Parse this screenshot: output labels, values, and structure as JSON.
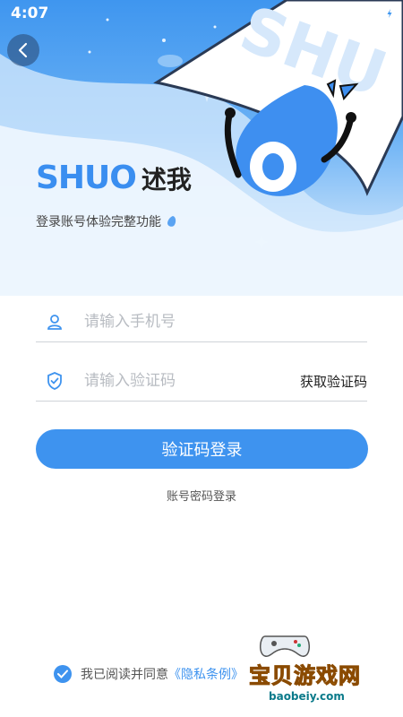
{
  "status_bar": {
    "time": "4:07"
  },
  "logo": {
    "en": "SHUO",
    "cn": "述我"
  },
  "subtitle": "登录账号体验完整功能",
  "phone_field": {
    "placeholder": "请输入手机号",
    "value": ""
  },
  "code_field": {
    "placeholder": "请输入验证码",
    "value": "",
    "get_code_label": "获取验证码"
  },
  "login_button": "验证码登录",
  "alt_login": "账号密码登录",
  "agreement": {
    "prefix": "我已阅读并同意",
    "privacy": "《隐私条例》",
    "checked": true
  },
  "watermark": {
    "text": "宝贝游戏网",
    "url": "baobeiy.com"
  },
  "colors": {
    "primary": "#3e93ef",
    "logo": "#3a8ef0"
  }
}
